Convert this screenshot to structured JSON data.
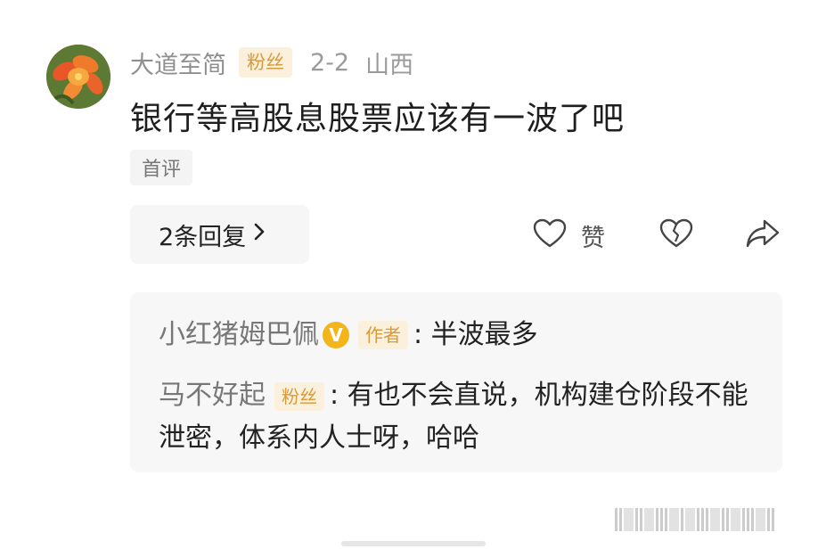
{
  "comment": {
    "username": "大道至简",
    "badge": "粉丝",
    "date": "2-2",
    "region": "山西",
    "text": "银行等高股息股票应该有一波了吧",
    "first_tag": "首评",
    "replies_label": "2条回复",
    "like_label": "赞"
  },
  "replies": [
    {
      "name": "小红猪姆巴佩",
      "verified": "V",
      "badge": "作者",
      "text": ": 半波最多"
    },
    {
      "name": "马不好起",
      "badge": "粉丝",
      "text": ": 有也不会直说，机构建仓阶段不能泄密，体系内人士呀，哈哈"
    }
  ],
  "colors": {
    "badge_bg": "#fbf0dc",
    "badge_text": "#d89a3a",
    "verified": "#f2b51a"
  },
  "icons": [
    "avatar-flower",
    "heart-icon",
    "broken-heart-icon",
    "share-icon",
    "chevron-right-icon"
  ]
}
